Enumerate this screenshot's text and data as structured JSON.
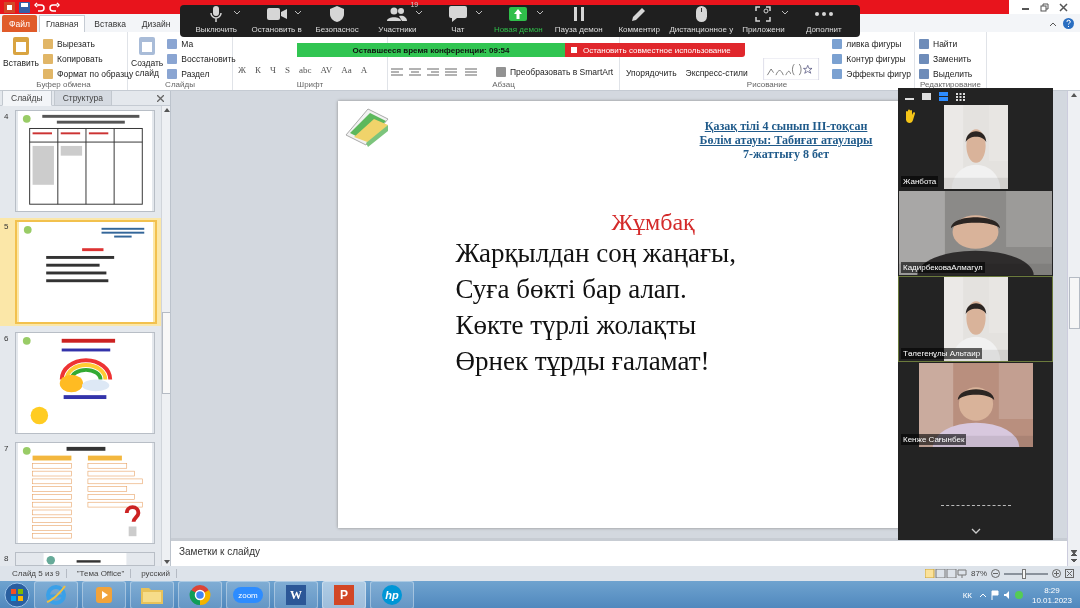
{
  "ribbon": {
    "tabs": [
      {
        "label": "Файл",
        "kind": "file",
        "selected": false
      },
      {
        "label": "Главная",
        "kind": "tab",
        "selected": true
      },
      {
        "label": "Вставка",
        "kind": "tab",
        "selected": false
      },
      {
        "label": "Дизайн",
        "kind": "tab",
        "selected": false
      }
    ],
    "groups": [
      {
        "title": "Буфер обмена",
        "kind": "clipboard",
        "big": [
          "Вставить"
        ],
        "items": [
          "Вырезать",
          "Копировать",
          "Формат по образцу"
        ]
      },
      {
        "title": "Слайды",
        "kind": "slides",
        "big": [
          "Создать слайд"
        ],
        "items": [
          "Ма",
          "Восстановить",
          "Раздел"
        ]
      },
      {
        "title": "Шрифт",
        "kind": "font",
        "tools": [
          "Ж",
          "К",
          "Ч",
          "S",
          "abc",
          "AV",
          "Aa",
          "A"
        ]
      },
      {
        "title": "Абзац",
        "kind": "paragraph",
        "items": [
          "Преобразовать в SmartArt"
        ]
      },
      {
        "title": "Рисование",
        "kind": "drawing",
        "big": [
          "Упорядочить",
          "Экспресс-стили"
        ],
        "items": [
          "ливка фигуры",
          "Контур фигуры",
          "Эффекты фигур"
        ]
      },
      {
        "title": "Редактирование",
        "kind": "editing",
        "items": [
          "Найти",
          "Заменить",
          "Выделить"
        ]
      }
    ]
  },
  "zoom_toolbar": {
    "buttons": [
      {
        "label": "Выключить",
        "kind": "mic",
        "caret": true
      },
      {
        "label": "Остановить в",
        "kind": "camera",
        "caret": true
      },
      {
        "label": "Безопаснос",
        "kind": "shield",
        "caret": false
      },
      {
        "label": "Участники",
        "kind": "people",
        "caret": true,
        "count": "19"
      },
      {
        "label": "Чат",
        "kind": "chat",
        "caret": true
      },
      {
        "label": "Новая демон",
        "kind": "share",
        "caret": true
      },
      {
        "label": "Пауза демон",
        "kind": "pause",
        "caret": false
      },
      {
        "label": "Комментир",
        "kind": "pen",
        "caret": false
      },
      {
        "label": "Дистанционное у",
        "kind": "mouse",
        "caret": false
      },
      {
        "label": "Приложени",
        "kind": "apps",
        "caret": true
      },
      {
        "label": "Дополнит",
        "kind": "more",
        "caret": false
      }
    ],
    "timer": "Оставшееся время конференции: 09:54",
    "stop_share": "Остановить совместное использование"
  },
  "slide_pane": {
    "tabs": [
      {
        "label": "Слайды",
        "selected": true
      },
      {
        "label": "Структура",
        "selected": false
      }
    ],
    "slides": [
      {
        "number": "4",
        "kind": "table",
        "selected": false
      },
      {
        "number": "5",
        "kind": "poem",
        "selected": true
      },
      {
        "number": "6",
        "kind": "rainbow",
        "selected": false
      },
      {
        "number": "7",
        "kind": "boxes",
        "selected": false
      },
      {
        "number": "8",
        "kind": "partial",
        "selected": false
      }
    ]
  },
  "slide": {
    "header": [
      "Қазақ тілі 4 сынып ІІІ-тоқсан",
      "Бөлім атауы: Табиғат атаулары",
      "7-жаттығу  8 бет"
    ],
    "title": "Жұмбақ",
    "lines": [
      "Жарқылдан соң жаңағы,",
      "Суға бөкті бар алап.",
      "Көкте түрлі жолақты",
      "Өрнек тұрды ғаламат!"
    ]
  },
  "notes": {
    "placeholder": "Заметки к слайду"
  },
  "video_panel": {
    "views": [
      {
        "kind": "minimize",
        "selected": false
      },
      {
        "kind": "single",
        "selected": false
      },
      {
        "kind": "speaker",
        "selected": true
      },
      {
        "kind": "grid",
        "selected": false
      }
    ],
    "tiles": [
      {
        "name": "Жанбота",
        "hand_raised": true,
        "active": false
      },
      {
        "name": "КадирбековаАлмагул",
        "hand_raised": false,
        "active": false
      },
      {
        "name": "Төлегенұлы Альтаир",
        "hand_raised": false,
        "active": true
      },
      {
        "name": "Кенже Сағынбек",
        "hand_raised": false,
        "active": false
      }
    ]
  },
  "status_bar": {
    "items": [
      "Слайд 5 из 9",
      "\"Тема Office\"",
      "русский"
    ],
    "zoom": "87%",
    "zoom_slider": {
      "level": 0.45
    }
  },
  "taskbar": {
    "apps": [
      {
        "kind": "ie",
        "selected": false
      },
      {
        "kind": "media",
        "selected": false
      },
      {
        "kind": "folder",
        "selected": false
      },
      {
        "kind": "chrome",
        "selected": false
      },
      {
        "kind": "zoom",
        "label": "zoom",
        "selected": false
      },
      {
        "kind": "word",
        "label": "W",
        "selected": false
      },
      {
        "kind": "powerpoint",
        "label": "P",
        "selected": true
      },
      {
        "kind": "hp",
        "label": "hp",
        "selected": false
      }
    ],
    "tray": {
      "language": "КК",
      "time": "8:29",
      "date": "10.01.2023"
    }
  }
}
